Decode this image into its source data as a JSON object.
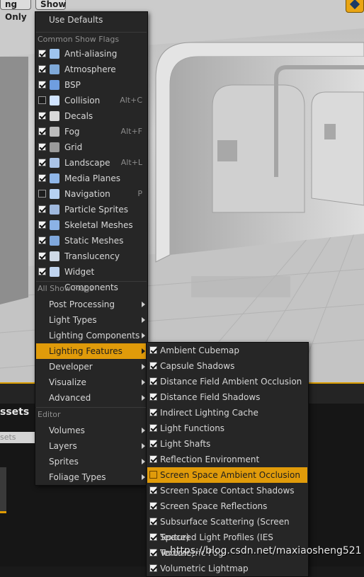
{
  "toolbar": {
    "lighting_only": "ng Only",
    "show": "Show"
  },
  "main_menu": {
    "use_defaults": "Use Defaults",
    "common_header": "Common Show Flags",
    "common": [
      {
        "label": "Anti-aliasing",
        "checked": true,
        "icon": "anti-aliasing-icon",
        "shortcut": ""
      },
      {
        "label": "Atmosphere",
        "checked": true,
        "icon": "atmosphere-icon",
        "shortcut": ""
      },
      {
        "label": "BSP",
        "checked": true,
        "icon": "bsp-icon",
        "shortcut": ""
      },
      {
        "label": "Collision",
        "checked": false,
        "icon": "collision-icon",
        "shortcut": "Alt+C"
      },
      {
        "label": "Decals",
        "checked": true,
        "icon": "decals-icon",
        "shortcut": ""
      },
      {
        "label": "Fog",
        "checked": true,
        "icon": "fog-icon",
        "shortcut": "Alt+F"
      },
      {
        "label": "Grid",
        "checked": true,
        "icon": "grid-icon",
        "shortcut": ""
      },
      {
        "label": "Landscape",
        "checked": true,
        "icon": "landscape-icon",
        "shortcut": "Alt+L"
      },
      {
        "label": "Media Planes",
        "checked": true,
        "icon": "media-planes-icon",
        "shortcut": ""
      },
      {
        "label": "Navigation",
        "checked": false,
        "icon": "navigation-icon",
        "shortcut": "P"
      },
      {
        "label": "Particle Sprites",
        "checked": true,
        "icon": "particle-sprites-icon",
        "shortcut": ""
      },
      {
        "label": "Skeletal Meshes",
        "checked": true,
        "icon": "skeletal-meshes-icon",
        "shortcut": ""
      },
      {
        "label": "Static Meshes",
        "checked": true,
        "icon": "static-meshes-icon",
        "shortcut": ""
      },
      {
        "label": "Translucency",
        "checked": true,
        "icon": "translucency-icon",
        "shortcut": ""
      },
      {
        "label": "Widget Components",
        "checked": true,
        "icon": "widget-components-icon",
        "shortcut": ""
      }
    ],
    "all_header": "All Show Flags",
    "all": [
      {
        "label": "Post Processing"
      },
      {
        "label": "Light Types"
      },
      {
        "label": "Lighting Components"
      },
      {
        "label": "Lighting Features",
        "highlight": true
      },
      {
        "label": "Developer"
      },
      {
        "label": "Visualize"
      },
      {
        "label": "Advanced"
      }
    ],
    "editor_header": "Editor",
    "editor": [
      {
        "label": "Volumes"
      },
      {
        "label": "Layers"
      },
      {
        "label": "Sprites"
      },
      {
        "label": "Foliage Types"
      }
    ]
  },
  "sub_menu": {
    "items": [
      {
        "label": "Ambient Cubemap",
        "checked": true
      },
      {
        "label": "Capsule Shadows",
        "checked": true
      },
      {
        "label": "Distance Field Ambient Occlusion",
        "checked": true
      },
      {
        "label": "Distance Field Shadows",
        "checked": true
      },
      {
        "label": "Indirect Lighting Cache",
        "checked": true
      },
      {
        "label": "Light Functions",
        "checked": true
      },
      {
        "label": "Light Shafts",
        "checked": true
      },
      {
        "label": "Reflection Environment",
        "checked": true
      },
      {
        "label": "Screen Space Ambient Occlusion",
        "checked": false,
        "highlight": true
      },
      {
        "label": "Screen Space Contact Shadows",
        "checked": true
      },
      {
        "label": "Screen Space Reflections",
        "checked": true
      },
      {
        "label": "Subsurface Scattering (Screen Space)",
        "checked": true
      },
      {
        "label": "Textured Light Profiles (IES Texture)",
        "checked": true
      },
      {
        "label": "Volumetric Fog",
        "checked": true
      },
      {
        "label": "Volumetric Lightmap",
        "checked": true
      }
    ]
  },
  "content_browser": {
    "title": "ssets",
    "search": "sets"
  },
  "watermark": "https://blog.csdn.net/maxiaosheng521",
  "colors": {
    "highlight": "#e09b0a",
    "menu_bg": "#262626"
  }
}
